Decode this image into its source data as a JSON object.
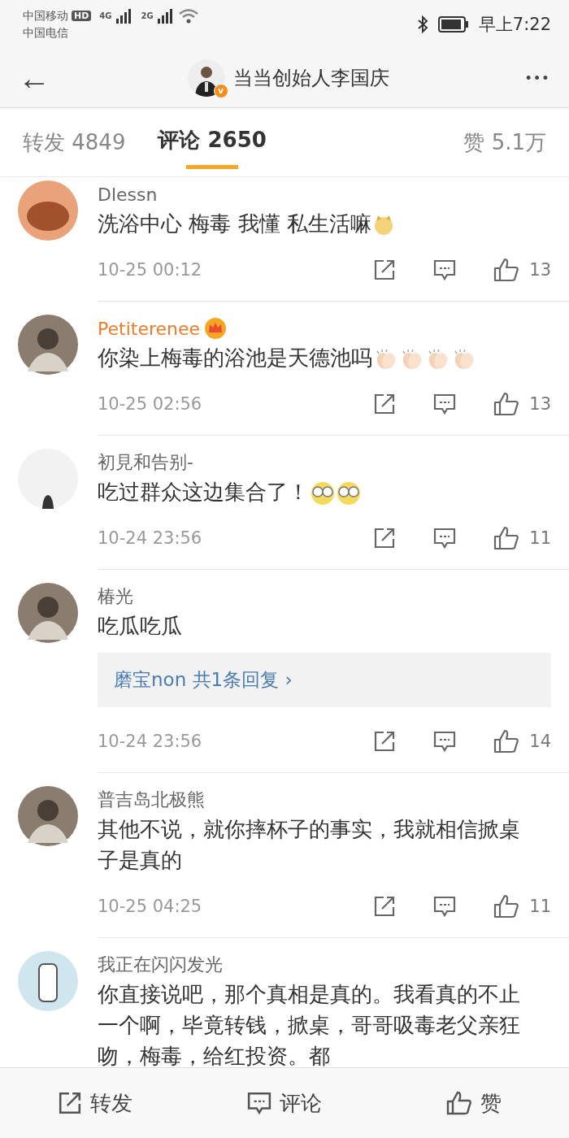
{
  "status_bar": {
    "carrier_1": "中国移动",
    "hd": "HD",
    "carrier_2": "中国电信",
    "net_1": "4G",
    "net_2": "2G",
    "time": "早上7:22"
  },
  "header": {
    "back": "←",
    "title": "当当创始人李国庆",
    "verified": "v",
    "more": "•••"
  },
  "tabs": [
    {
      "label": "转发 4849",
      "selected": false
    },
    {
      "label": "评论 2650",
      "selected": true
    }
  ],
  "likes_tab": {
    "label": "赞 5.1万"
  },
  "comments": [
    {
      "name": "Dlessn",
      "vip": false,
      "text": "洗浴中心 梅毒 我懂 私生活嘛",
      "emojis": [
        {
          "kind": "face"
        }
      ],
      "time": "10-25 00:12",
      "likes": "13"
    },
    {
      "name": "Petiterenee",
      "vip": true,
      "text": "你染上梅毒的浴池是天德池吗",
      "emojis": [
        {
          "kind": "clap"
        },
        {
          "kind": "clap"
        },
        {
          "kind": "clap"
        },
        {
          "kind": "clap"
        }
      ],
      "time": "10-25 02:56",
      "likes": "13"
    },
    {
      "name": "初見和告别-",
      "vip": false,
      "text": "吃过群众这边集合了！",
      "emojis": [
        {
          "kind": "glasses"
        },
        {
          "kind": "glasses"
        }
      ],
      "time": "10-24 23:56",
      "likes": "11"
    },
    {
      "name": "椿光",
      "vip": false,
      "text": "吃瓜吃瓜",
      "reply": {
        "user": "磨宝non",
        "summary": "共1条回复",
        "arrow": "›"
      },
      "time": "10-24 23:56",
      "likes": "14"
    },
    {
      "name": "普吉岛北极熊",
      "vip": false,
      "text": "其他不说，就你摔杯子的事实，我就相信掀桌子是真的",
      "time": "10-25 04:25",
      "likes": "11"
    },
    {
      "name": "我正在闪闪发光",
      "vip": false,
      "text": "你直接说吧，那个真相是真的。我看真的不止一个啊，毕竟转钱，掀桌，哥哥吸毒老父亲狂吻，梅毒，给红投资。都"
    }
  ],
  "bottom_bar": [
    {
      "label": "转发",
      "kind": "share"
    },
    {
      "label": "评论",
      "kind": "comment"
    },
    {
      "label": "赞",
      "kind": "like"
    }
  ]
}
